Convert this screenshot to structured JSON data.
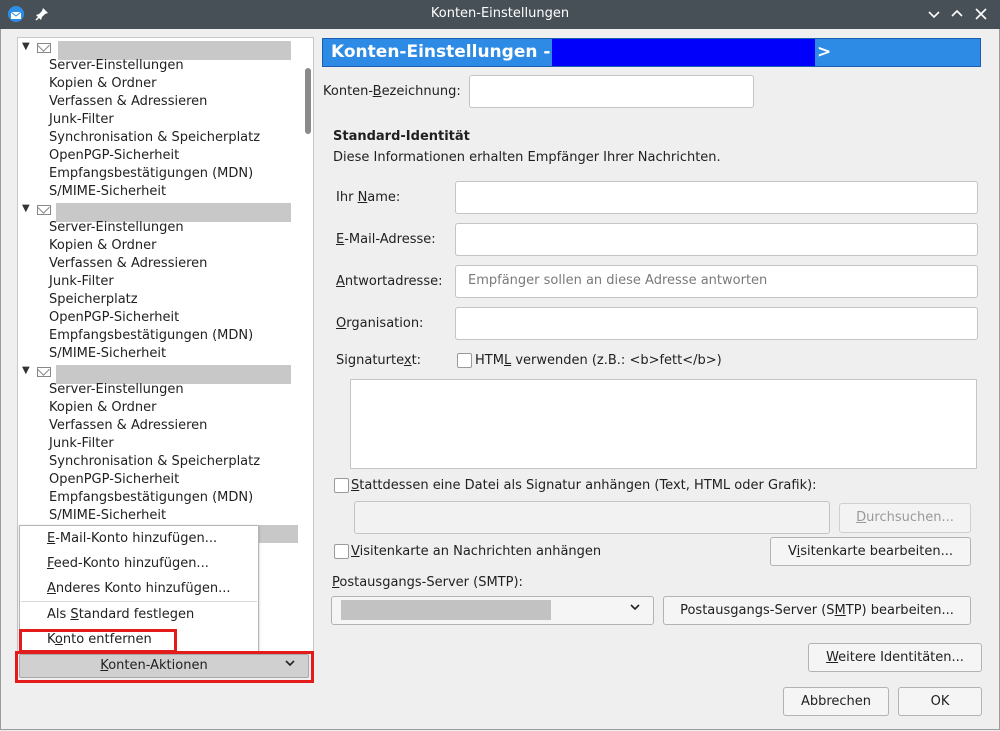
{
  "window": {
    "title": "Konten-Einstellungen",
    "colors": {
      "titlebar": "#475057",
      "header_bg": "#2d8be5",
      "highlight": "#e31b1b"
    }
  },
  "tree": {
    "accounts": [
      {
        "items": [
          "Server-Einstellungen",
          "Kopien & Ordner",
          "Verfassen & Adressieren",
          "Junk-Filter",
          "Synchronisation & Speicherplatz",
          "OpenPGP-Sicherheit",
          "Empfangsbestätigungen (MDN)",
          "S/MIME-Sicherheit"
        ]
      },
      {
        "items": [
          "Server-Einstellungen",
          "Kopien & Ordner",
          "Verfassen & Adressieren",
          "Junk-Filter",
          "Speicherplatz",
          "OpenPGP-Sicherheit",
          "Empfangsbestätigungen (MDN)",
          "S/MIME-Sicherheit"
        ]
      },
      {
        "items": [
          "Server-Einstellungen",
          "Kopien & Ordner",
          "Verfassen & Adressieren",
          "Junk-Filter",
          "Synchronisation & Speicherplatz",
          "OpenPGP-Sicherheit",
          "Empfangsbestätigungen (MDN)",
          "S/MIME-Sicherheit"
        ]
      }
    ]
  },
  "menu": {
    "add_email": {
      "pre": "",
      "u": "E",
      "post": "-Mail-Konto hinzufügen..."
    },
    "add_feed": {
      "pre": "",
      "u": "F",
      "post": "eed-Konto hinzufügen..."
    },
    "add_other": {
      "pre": "",
      "u": "A",
      "post": "nderes Konto hinzufügen..."
    },
    "set_default": {
      "pre": "Als ",
      "u": "S",
      "post": "tandard festlegen"
    },
    "remove": {
      "pre": "K",
      "u": "o",
      "post": "nto entfernen"
    }
  },
  "actions_button": {
    "pre": "",
    "u": "K",
    "post": "onten-Aktionen"
  },
  "header": {
    "title": "Konten-Einstellungen - <",
    "end": ">"
  },
  "form": {
    "account_name_label": {
      "pre": "Konten-",
      "u": "B",
      "post": "ezeichnung:"
    },
    "identity_title": "Standard-Identität",
    "identity_desc": "Diese Informationen erhalten Empfänger Ihrer Nachrichten.",
    "name_label": {
      "pre": "Ihr ",
      "u": "N",
      "post": "ame:"
    },
    "email_label": {
      "pre": "",
      "u": "E",
      "post": "-Mail-Adresse:"
    },
    "reply_label": {
      "pre": "",
      "u": "A",
      "post": "ntwortadresse:"
    },
    "reply_placeholder": "Empfänger sollen an diese Adresse antworten",
    "org_label": {
      "pre": "",
      "u": "O",
      "post": "rganisation:"
    },
    "sig_label": {
      "pre": "Signaturte",
      "u": "x",
      "post": "t:"
    },
    "html_label": {
      "pre": "HTM",
      "u": "L",
      "post": " verwenden (z.B.: <b>fett</b>)"
    },
    "attach_sig_label": {
      "pre": "",
      "u": "S",
      "post": "tattdessen eine Datei als Signatur anhängen (Text, HTML oder Grafik):"
    },
    "browse_button": {
      "pre": "",
      "u": "D",
      "post": "urchsuchen..."
    },
    "vcard_label": {
      "pre": "",
      "u": "V",
      "post": "isitenkarte an Nachrichten anhängen"
    },
    "vcard_button": {
      "pre": "V",
      "u": "i",
      "post": "sitenkarte bearbeiten..."
    },
    "smtp_label": {
      "pre": "",
      "u": "P",
      "post": "ostausgangs-Server (SMTP):"
    },
    "smtp_button": {
      "pre": "Postausgangs-Server (S",
      "u": "M",
      "post": "TP) bearbeiten..."
    },
    "more_identities_button": {
      "pre": "",
      "u": "W",
      "post": "eitere Identitäten..."
    }
  },
  "footer": {
    "cancel": "Abbrechen",
    "ok": "OK"
  }
}
